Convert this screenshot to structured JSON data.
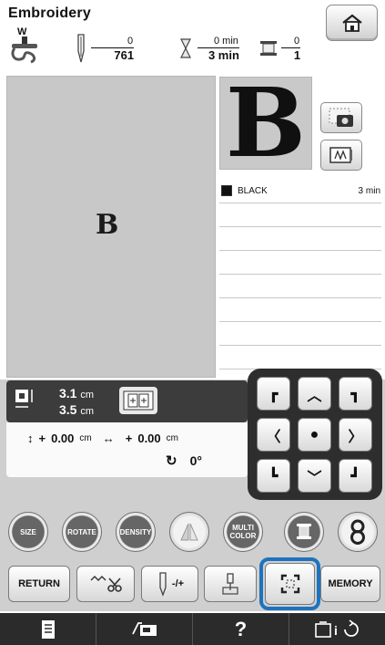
{
  "header": {
    "title": "Embroidery",
    "presser_foot": "W",
    "stitches": {
      "current": "0",
      "total": "761"
    },
    "time": {
      "current": "0 min",
      "total": "3 min"
    },
    "colors": {
      "current": "0",
      "total": "1"
    }
  },
  "color_list": [
    {
      "name": "BLACK",
      "time": "3 min",
      "swatch": "#111111"
    }
  ],
  "preview": {
    "letter": "B"
  },
  "info": {
    "width": "3.1",
    "height": "3.5",
    "unit": "cm",
    "offset_y_prefix": "+",
    "offset_y": "0.00",
    "offset_x_prefix": "+",
    "offset_x": "0.00",
    "rotate_value": "0°"
  },
  "buttons": {
    "size": "SIZE",
    "rotate": "ROTATE",
    "density": "DENSITY",
    "multi_color": "MULTI COLOR",
    "return": "RETURN",
    "needle_plus_minus": "-/+",
    "memory": "MEMORY"
  },
  "colors": {
    "highlight": "#1e73be",
    "pad_bg": "#2e2e2e",
    "canvas_bg": "#c8c8c8"
  }
}
